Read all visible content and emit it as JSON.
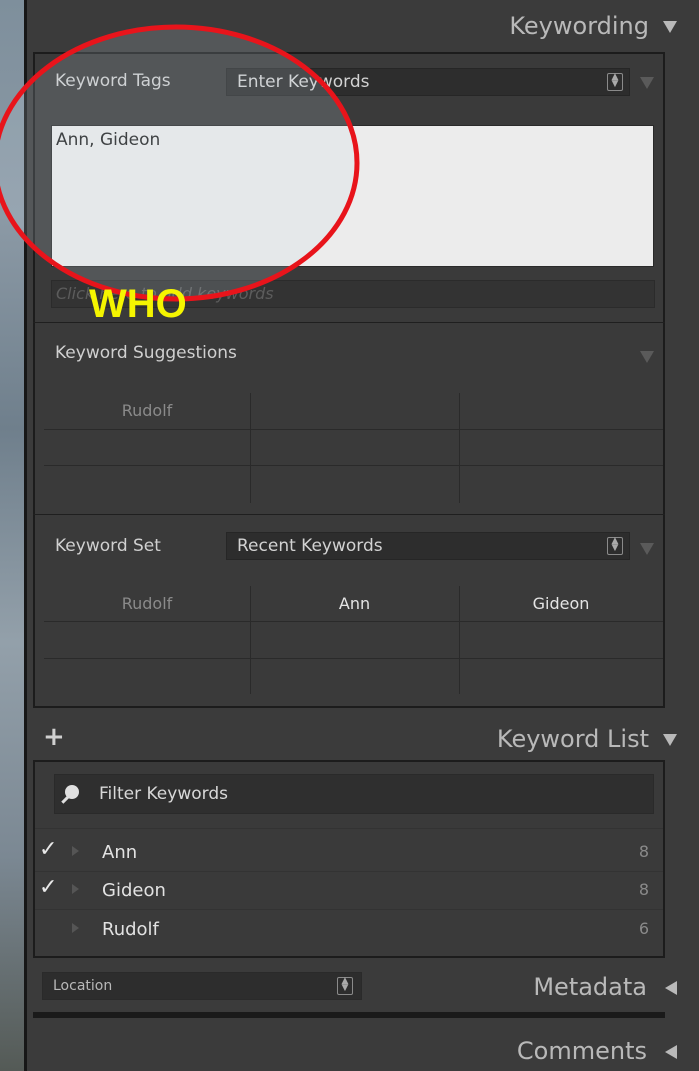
{
  "panels": {
    "keywording": {
      "title": "Keywording",
      "keyword_tags_label": "Keyword Tags",
      "keyword_tags_mode": "Enter Keywords",
      "keywords_text": "Ann, Gideon",
      "add_keywords_placeholder": "Click here to add keywords",
      "suggestions_label": "Keyword Suggestions",
      "suggestions": [
        "Rudolf",
        "",
        "",
        "",
        "",
        "",
        "",
        "",
        ""
      ],
      "keyword_set_label": "Keyword Set",
      "keyword_set_value": "Recent Keywords",
      "keyword_set": [
        "Rudolf",
        "Ann",
        "Gideon",
        "",
        "",
        "",
        "",
        "",
        ""
      ]
    },
    "keyword_list": {
      "title": "Keyword List",
      "add_icon": "+",
      "filter_placeholder": "Filter Keywords",
      "items": [
        {
          "name": "Ann",
          "count": "8",
          "checked": true
        },
        {
          "name": "Gideon",
          "count": "8",
          "checked": true
        },
        {
          "name": "Rudolf",
          "count": "6",
          "checked": false
        }
      ]
    },
    "metadata": {
      "title": "Metadata",
      "preset": "Location"
    },
    "comments": {
      "title": "Comments"
    }
  },
  "annotation": {
    "text": "WHO",
    "circle_color": "#e8141b",
    "text_color": "#f5f500"
  },
  "icons": {
    "check": "✓",
    "collapse": "triangle-down-icon",
    "expand": "triangle-left-icon"
  }
}
